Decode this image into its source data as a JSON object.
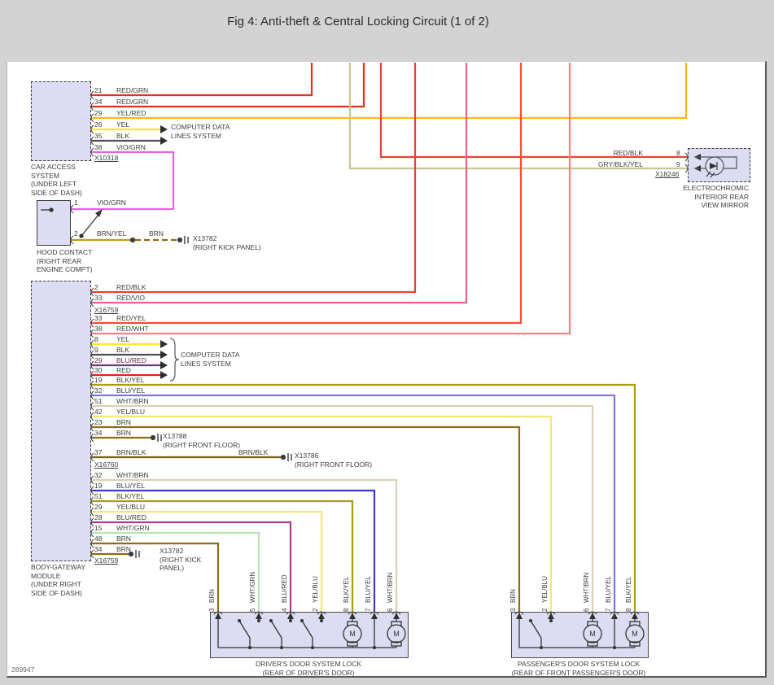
{
  "header": {
    "title": "Fig 4: Anti-theft & Central Locking Circuit (1 of 2)"
  },
  "sheet_code": "289947",
  "symbols": {
    "motor_letter": "M"
  },
  "colors": {
    "red_grn": "#e53020",
    "yel_red": "#ffb61e",
    "yel": "#f7ec1f",
    "blk": "#4f4f4f",
    "vio_grn": "#e365dd",
    "brn_yel": "#bf9b1f",
    "brn": "#8e6b14",
    "red_blk": "#ea4038",
    "gry_blk_yel": "#c9c398",
    "red_vio": "#f75f93",
    "red_yel": "#f64e31",
    "red_wht": "#f98080",
    "red": "#ec1c24",
    "blu_red": "#3a30cc",
    "blu_red_b": "#8c4fd8",
    "stripe_red": "#e02020",
    "blk_yel": "#ab9b14",
    "blu_yel": "#7a7ad8",
    "blu_yel_b": "#3c3ccc",
    "wht_brn": "#d9d1b5",
    "yel_blu": "#f2e96e",
    "wht_grn": "#b7e3b7",
    "brn_blk": "#7c5e10",
    "box_fill": "#dcdcf2",
    "bg": "#d3d3d3",
    "line": "#3d3d3d"
  },
  "car_access": {
    "name": "CAR ACCESS\nSYSTEM\n(UNDER LEFT\nSIDE OF DASH)",
    "connector": "X10318",
    "data_note": "COMPUTER DATA\nLINES SYSTEM",
    "pins": [
      {
        "num": "21",
        "color": "RED/GRN"
      },
      {
        "num": "34",
        "color": "RED/GRN"
      },
      {
        "num": "29",
        "color": "YEL/RED"
      },
      {
        "num": "26",
        "color": "YEL"
      },
      {
        "num": "35",
        "color": "BLK"
      },
      {
        "num": "38",
        "color": "VIO/GRN"
      }
    ]
  },
  "mirror": {
    "name": "ELECTROCHROMIC\nINTERIOR REAR\nVIEW MIRROR",
    "connector": "X18246",
    "pins": [
      {
        "num": "8",
        "color": "RED/BLK"
      },
      {
        "num": "9",
        "color": "GRY/BLK/YEL"
      }
    ]
  },
  "hood_contact": {
    "name": "HOOD CONTACT\n(RIGHT REAR\nENGINE COMPT)",
    "pins": [
      {
        "num": "1",
        "color": "VIO/GRN"
      },
      {
        "num": "2",
        "color": "BRN/YEL"
      }
    ],
    "splice_color": "BRN",
    "splice_ref": "X13782\n(RIGHT KICK PANEL)"
  },
  "body_gateway": {
    "name": "BODY-GATEWAY\nMODULE\n(UNDER RIGHT\nSIDE OF DASH)",
    "connector_top": "X16759",
    "connector_mid": "X16760",
    "connector_bottom": "X16759",
    "data_note": "COMPUTER DATA\nLINES SYSTEM",
    "pins": [
      {
        "num": "2",
        "color": "RED/BLK"
      },
      {
        "num": "33",
        "color": "RED/VIO"
      },
      {
        "num": "33",
        "color": "RED/YEL"
      },
      {
        "num": "38",
        "color": "RED/WHT"
      },
      {
        "num": "8",
        "color": "YEL"
      },
      {
        "num": "9",
        "color": "BLK"
      },
      {
        "num": "29",
        "color": "BLU/RED"
      },
      {
        "num": "30",
        "color": "RED"
      },
      {
        "num": "19",
        "color": "BLK/YEL"
      },
      {
        "num": "32",
        "color": "BLU/YEL"
      },
      {
        "num": "51",
        "color": "WHT/BRN"
      },
      {
        "num": "42",
        "color": "YEL/BLU"
      },
      {
        "num": "23",
        "color": "BRN"
      },
      {
        "num": "34",
        "color": "BRN"
      },
      {
        "num": "37",
        "color": "BRN/BLK"
      },
      {
        "num": "32",
        "color": "WHT/BRN"
      },
      {
        "num": "19",
        "color": "BLU/YEL"
      },
      {
        "num": "51",
        "color": "BLK/YEL"
      },
      {
        "num": "29",
        "color": "YEL/BLU"
      },
      {
        "num": "28",
        "color": "BLU/RED"
      },
      {
        "num": "15",
        "color": "WHT/GRN"
      },
      {
        "num": "48",
        "color": "BRN"
      },
      {
        "num": "34",
        "color": "BRN"
      }
    ],
    "branch_x13788": "X13788\n(RIGHT FRONT FLOOR)",
    "branch_x13786_wire": "BRN/BLK",
    "branch_x13786": "X13786\n(RIGHT FRONT FLOOR)",
    "branch_x13782": "X13782\n(RIGHT KICK\nPANEL)"
  },
  "driver_lock": {
    "name": "DRIVER'S DOOR SYSTEM LOCK\n(REAR OF DRIVER'S DOOR)",
    "pins": [
      {
        "num": "3",
        "color": "BRN"
      },
      {
        "num": "5",
        "color": "WHT/GRN"
      },
      {
        "num": "4",
        "color": "BLU/RED"
      },
      {
        "num": "2",
        "color": "YEL/BLU"
      },
      {
        "num": "8",
        "color": "BLK/YEL"
      },
      {
        "num": "7",
        "color": "BLU/YEL"
      },
      {
        "num": "6",
        "color": "WHT/BRN"
      }
    ]
  },
  "passenger_lock": {
    "name": "PASSENGER'S DOOR SYSTEM LOCK\n(REAR OF FRONT PASSENGER'S DOOR)",
    "pins": [
      {
        "num": "3",
        "color": "BRN"
      },
      {
        "num": "2",
        "color": "YEL/BLU"
      },
      {
        "num": "6",
        "color": "WHT/BRN"
      },
      {
        "num": "7",
        "color": "BLU/YEL"
      },
      {
        "num": "8",
        "color": "BLK/YEL"
      }
    ]
  }
}
